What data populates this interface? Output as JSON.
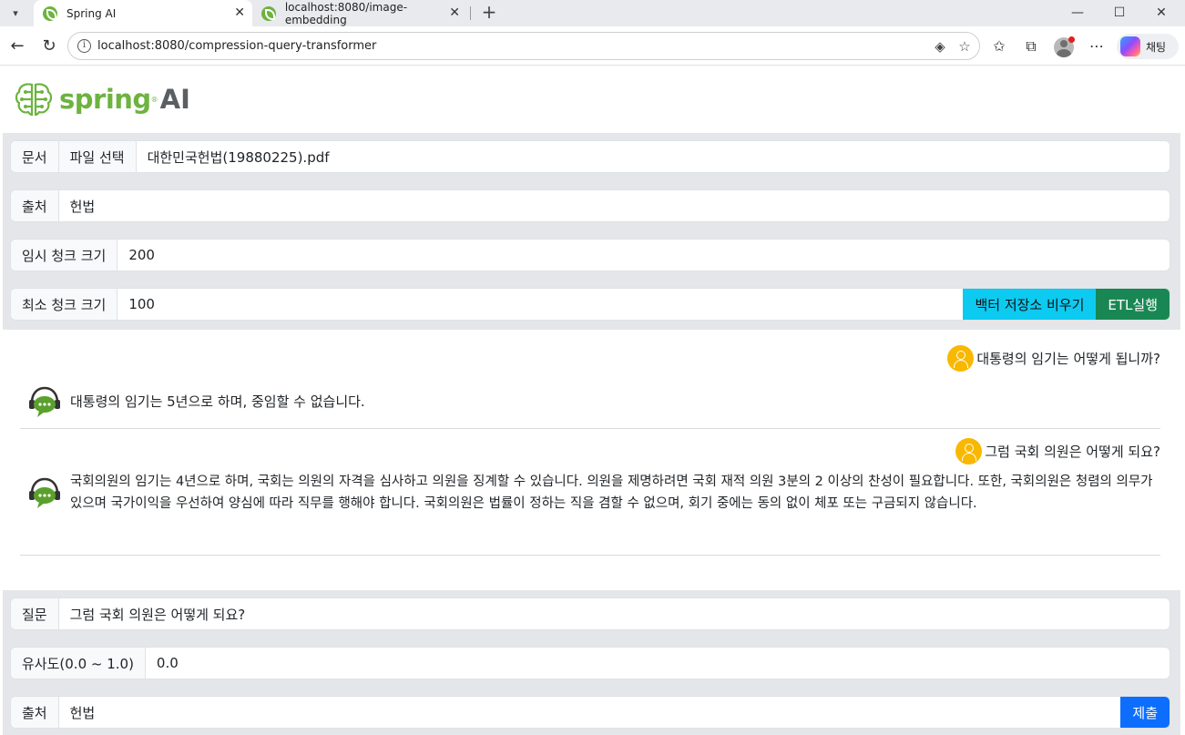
{
  "browser": {
    "tabs": [
      {
        "title": "Spring AI",
        "active": true
      },
      {
        "title": "localhost:8080/image-embedding",
        "active": false
      }
    ],
    "url": "localhost:8080/compression-query-transformer",
    "copilot_label": "채팅"
  },
  "header": {
    "brand_name": "spring",
    "brand_suffix": "AI",
    "brand_color": "#6db33f"
  },
  "etl": {
    "document_label": "문서",
    "file_button": "파일 선택",
    "file_name": "대한민국헌법(19880225).pdf",
    "source_label": "출처",
    "source_value": "헌법",
    "chunk_size_label": "임시 청크 크기",
    "chunk_size_value": "200",
    "min_chunk_label": "최소 청크 크기",
    "min_chunk_value": "100",
    "clear_button": "백터 저장소 비우기",
    "run_button": "ETL실행"
  },
  "chat": {
    "messages": [
      {
        "question": "대통령의 임기는 어떻게 됩니까?",
        "answer": "대통령의 임기는 5년으로 하며, 중임할 수 없습니다."
      },
      {
        "question": "그럼 국회 의원은 어떻게 되요?",
        "answer": "국회의원의 임기는 4년으로 하며, 국회는 의원의 자격을 심사하고 의원을 징계할 수 있습니다. 의원을 제명하려면 국회 재적 의원 3분의 2 이상의 찬성이 필요합니다. 또한, 국회의원은 청렴의 의무가 있으며 국가이익을 우선하여 양심에 따라 직무를 행해야 합니다. 국회의원은 법률이 정하는 직을 겸할 수 없으며, 회기 중에는 동의 없이 체포 또는 구금되지 않습니다."
      }
    ]
  },
  "query": {
    "question_label": "질문",
    "question_value": "그럼 국회 의원은 어떻게 되요?",
    "similarity_label": "유사도(0.0 ~ 1.0)",
    "similarity_value": "0.0",
    "source_label": "출처",
    "source_value": "헌법",
    "submit_button": "제출"
  }
}
